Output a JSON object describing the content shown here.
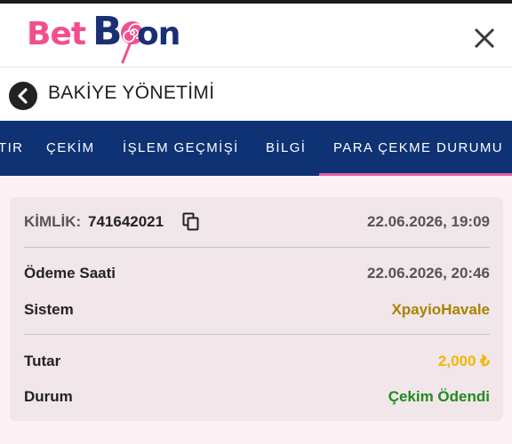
{
  "logo": {
    "part1": "Bet",
    "part2": "B",
    "part3": "on"
  },
  "title": "BAKİYE YÖNETİMİ",
  "tabs": [
    {
      "label": "TIR"
    },
    {
      "label": "ÇEKİM"
    },
    {
      "label": "İŞLEM GEÇMİŞİ"
    },
    {
      "label": "BİLGİ"
    },
    {
      "label": "PARA ÇEKME DURUMU",
      "active": true
    }
  ],
  "transaction": {
    "id_label": "KİMLİK:",
    "id_value": "741642021",
    "created": "22.06.2026, 19:09",
    "rows": [
      {
        "label": "Ödeme Saati",
        "value": "22.06.2026, 20:46",
        "color": "#555555"
      },
      {
        "label": "Sistem",
        "value": "XpayioHavale",
        "color": "#a98200"
      },
      {
        "label": "Tutar",
        "value": "2,000 ₺",
        "color": "#f2b600"
      },
      {
        "label": "Durum",
        "value": "Çekim Ödendi",
        "color": "#1f8a1f"
      }
    ]
  },
  "colors": {
    "brand_pink": "#f0508d",
    "brand_navy": "#1a2f74",
    "tabs_bg": "#0e3273",
    "tab_indicator": "#e85ba4"
  },
  "icons": [
    "close-icon",
    "back-arrow-icon",
    "copy-icon",
    "lollipop-logo-icon"
  ]
}
